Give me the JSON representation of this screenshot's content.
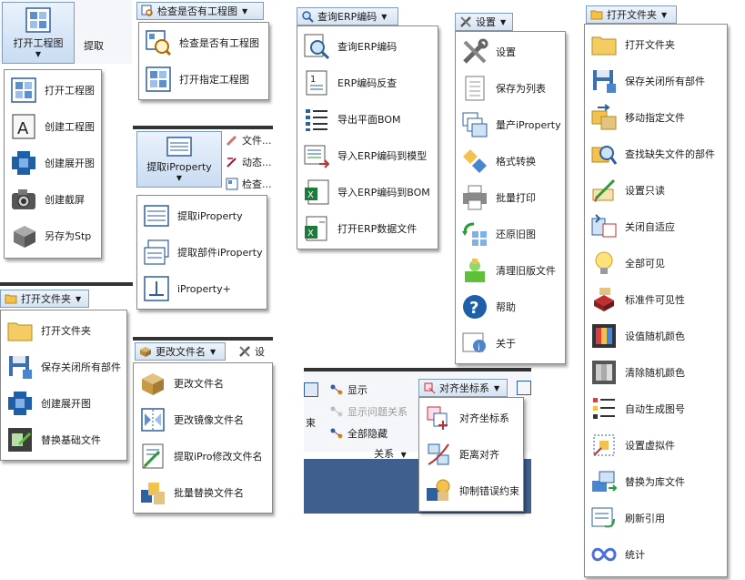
{
  "panel_drawing": {
    "button_label": "打开工程图",
    "side_label": "提取",
    "items": [
      {
        "label": "打开工程图",
        "icon": "open-drawing-icon"
      },
      {
        "label": "创建工程图",
        "icon": "create-drawing-icon"
      },
      {
        "label": "创建展开图",
        "icon": "flat-pattern-icon"
      },
      {
        "label": "创建截屏",
        "icon": "camera-icon"
      },
      {
        "label": "另存为Stp",
        "icon": "save-stp-icon"
      }
    ]
  },
  "panel_check": {
    "button_label": "检查是否有工程图",
    "items": [
      {
        "label": "检查是否有工程图",
        "icon": "check-drawing-icon"
      },
      {
        "label": "打开指定工程图",
        "icon": "open-specific-drawing-icon"
      }
    ]
  },
  "panel_iprop": {
    "button_label": "提取iProperty",
    "side_items": [
      "文件...",
      "动态...",
      "检查..."
    ],
    "items": [
      {
        "label": "提取iProperty",
        "icon": "iproperty-icon"
      },
      {
        "label": "提取部件iProperty",
        "icon": "assembly-iproperty-icon"
      },
      {
        "label": "iProperty+",
        "icon": "iproperty-plus-icon"
      }
    ]
  },
  "panel_openfolder_small": {
    "button_label": "打开文件夹",
    "items": [
      {
        "label": "打开文件夹",
        "icon": "folder-icon"
      },
      {
        "label": "保存关闭所有部件",
        "icon": "save-close-icon"
      },
      {
        "label": "创建展开图",
        "icon": "flat-pattern-icon"
      },
      {
        "label": "替换基础文件",
        "icon": "replace-base-icon"
      }
    ]
  },
  "panel_rename": {
    "button_label": "更改文件名",
    "side_label": "设",
    "items": [
      {
        "label": "更改文件名",
        "icon": "rename-icon"
      },
      {
        "label": "更改镜像文件名",
        "icon": "mirror-rename-icon"
      },
      {
        "label": "提取iPro修改文件名",
        "icon": "ipro-rename-icon"
      },
      {
        "label": "批量替换文件名",
        "icon": "batch-rename-icon"
      }
    ]
  },
  "panel_erp": {
    "button_label": "查询ERP编码",
    "items": [
      {
        "label": "查询ERP编码",
        "icon": "query-erp-icon"
      },
      {
        "label": "ERP编码反查",
        "icon": "erp-reverse-icon"
      },
      {
        "label": "导出平面BOM",
        "icon": "export-bom-icon"
      },
      {
        "label": "导入ERP编码到模型",
        "icon": "import-erp-model-icon"
      },
      {
        "label": "导入ERP编码到BOM",
        "icon": "import-erp-bom-icon"
      },
      {
        "label": "打开ERP数据文件",
        "icon": "open-erp-file-icon"
      }
    ]
  },
  "panel_relation": {
    "left_items": [
      {
        "label": "显示",
        "disabled": false
      },
      {
        "label": "显示问题关系",
        "disabled": true
      },
      {
        "label": "全部隐藏",
        "disabled": false
      }
    ],
    "left_edge_label": "束",
    "group_label": "关系",
    "button_label": "对齐坐标系",
    "items": [
      {
        "label": "对齐坐标系",
        "icon": "align-coordinate-icon"
      },
      {
        "label": "距离对齐",
        "icon": "distance-align-icon"
      },
      {
        "label": "抑制错误约束",
        "icon": "suppress-constraint-icon"
      }
    ]
  },
  "panel_settings": {
    "button_label": "设置",
    "items": [
      {
        "label": "设置",
        "icon": "wrench-icon"
      },
      {
        "label": "保存为列表",
        "icon": "save-list-icon"
      },
      {
        "label": "量产iProperty",
        "icon": "mass-iproperty-icon"
      },
      {
        "label": "格式转换",
        "icon": "format-convert-icon"
      },
      {
        "label": "批量打印",
        "icon": "printer-icon"
      },
      {
        "label": "还原旧图",
        "icon": "restore-icon"
      },
      {
        "label": "清理旧版文件",
        "icon": "cleanup-icon"
      },
      {
        "label": "帮助",
        "icon": "help-icon"
      },
      {
        "label": "关于",
        "icon": "about-icon"
      }
    ]
  },
  "panel_openfolder_big": {
    "button_label": "打开文件夹",
    "items": [
      {
        "label": "打开文件夹",
        "icon": "folder-icon"
      },
      {
        "label": "保存关闭所有部件",
        "icon": "save-close-icon"
      },
      {
        "label": "移动指定文件",
        "icon": "move-file-icon"
      },
      {
        "label": "查找缺失文件的部件",
        "icon": "find-missing-icon"
      },
      {
        "label": "设置只读",
        "icon": "readonly-icon"
      },
      {
        "label": "关闭自适应",
        "icon": "adaptive-off-icon"
      },
      {
        "label": "全部可见",
        "icon": "bulb-icon"
      },
      {
        "label": "标准件可见性",
        "icon": "standard-part-icon"
      },
      {
        "label": "设值随机颜色",
        "icon": "random-color-icon"
      },
      {
        "label": "清除随机颜色",
        "icon": "clear-color-icon"
      },
      {
        "label": "自动生成图号",
        "icon": "auto-number-icon"
      },
      {
        "label": "设置虚拟件",
        "icon": "virtual-part-icon"
      },
      {
        "label": "替换为库文件",
        "icon": "library-replace-icon"
      },
      {
        "label": "刷新引用",
        "icon": "refresh-ref-icon"
      },
      {
        "label": "统计",
        "icon": "statistics-icon"
      }
    ]
  },
  "colors": {
    "ribbon_blue": "#d5e3f3",
    "accent": "#2e5f9e",
    "folder": "#f2c14e",
    "dark_blue": "#1f3f6d"
  }
}
